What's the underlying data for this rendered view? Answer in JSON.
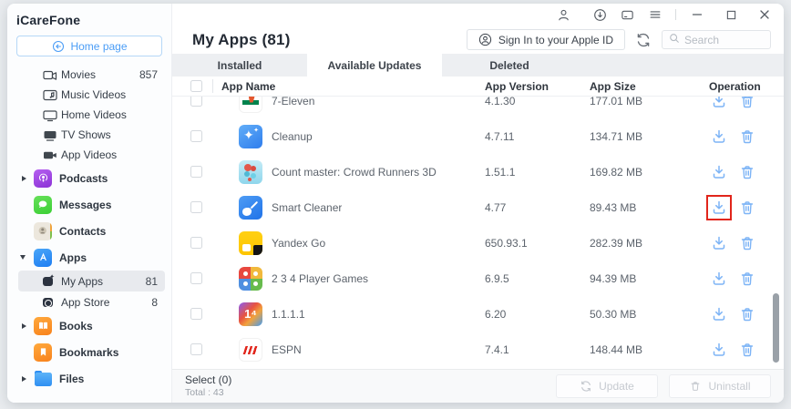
{
  "window": {
    "app_title": "iCareFone"
  },
  "titlebar": {
    "icons": [
      "account-icon",
      "download-circle-icon",
      "feedback-icon",
      "menu-icon",
      "minimize-icon",
      "maximize-icon",
      "close-icon"
    ]
  },
  "sidebar": {
    "home_button": "Home page",
    "library": [
      {
        "label": "Movies",
        "count": "857",
        "icon": "movie-camera-icon"
      },
      {
        "label": "Music Videos",
        "icon": "music-video-icon"
      },
      {
        "label": "Home Videos",
        "icon": "monitor-icon"
      },
      {
        "label": "TV Shows",
        "icon": "tv-icon"
      },
      {
        "label": "App Videos",
        "icon": "video-camera-icon"
      }
    ],
    "sections": [
      {
        "label": "Podcasts",
        "icon": "podcasts-icon"
      },
      {
        "label": "Messages",
        "icon": "messages-icon"
      },
      {
        "label": "Contacts",
        "icon": "contacts-icon"
      },
      {
        "label": "Apps",
        "icon": "app-store-icon"
      },
      {
        "label": "Books",
        "icon": "books-icon"
      },
      {
        "label": "Bookmarks",
        "icon": "bookmarks-icon"
      },
      {
        "label": "Files",
        "icon": "folder-icon"
      }
    ],
    "apps_children": [
      {
        "label": "My Apps",
        "count": "81",
        "selected": true
      },
      {
        "label": "App Store",
        "count": "8"
      }
    ]
  },
  "header": {
    "title": "My Apps (81)",
    "sign_in_label": "Sign In to your Apple ID",
    "search_placeholder": "Search"
  },
  "tabs": [
    {
      "label": "Installed",
      "active": false
    },
    {
      "label": "Available Updates",
      "active": true
    },
    {
      "label": "Deleted",
      "active": false
    }
  ],
  "table": {
    "columns": [
      "App Name",
      "App Version",
      "App Size",
      "Operation"
    ],
    "rows": [
      {
        "name": "7-Eleven",
        "version": "4.1.30",
        "size": "177.01 MB",
        "icon": "seven-eleven"
      },
      {
        "name": "Cleanup",
        "version": "4.7.11",
        "size": "134.71 MB",
        "icon": "cleanup"
      },
      {
        "name": "Count master: Crowd Runners 3D",
        "version": "1.51.1",
        "size": "169.82 MB",
        "icon": "count-master"
      },
      {
        "name": "Smart Cleaner",
        "version": "4.77",
        "size": "89.43 MB",
        "icon": "smart-cleaner",
        "highlight_download": true
      },
      {
        "name": "Yandex Go",
        "version": "650.93.1",
        "size": "282.39 MB",
        "icon": "yandex-go"
      },
      {
        "name": "2 3 4 Player Games",
        "version": "6.9.5",
        "size": "94.39 MB",
        "icon": "player-games"
      },
      {
        "name": "1.1.1.1",
        "version": "6.20",
        "size": "50.30 MB",
        "icon": "one"
      },
      {
        "name": "ESPN",
        "version": "7.4.1",
        "size": "148.44 MB",
        "icon": "espn"
      }
    ]
  },
  "footer": {
    "select_label": "Select (0)",
    "total_label": "Total : 43",
    "update_label": "Update",
    "uninstall_label": "Uninstall"
  },
  "colors": {
    "accent_blue": "#4b9df6",
    "operation_icon_blue": "#7db4f6",
    "highlight_red": "#e1251b"
  }
}
